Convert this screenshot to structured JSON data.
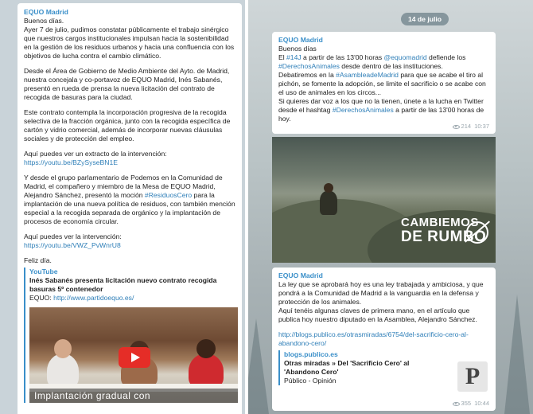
{
  "left_message": {
    "sender": "EQUO Madrid",
    "greeting": "Buenos días.",
    "p1": "Ayer 7 de julio, pudimos constatar públicamente el trabajo sinérgico que nuestros cargos institucionales impulsan hacia la sostenibilidad en la gestión de los residuos urbanos y hacia una confluencia con los objetivos de lucha contra el cambio climático.",
    "p2": "Desde el Área de Gobierno de Medio Ambiente del Ayto. de Madrid, nuestra concejala y co-portavoz de EQUO Madrid, Inés Sabanés, presentó en rueda de prensa la nueva licitación del contrato de recogida de basuras para la ciudad.",
    "p3": "Este contrato contempla la incorporación progresiva de la recogida selectiva de la fracción orgánica, junto con la recogida específica de cartón y vidrio comercial, además de incorporar nuevas cláusulas sociales y de protección del empleo.",
    "p4_text": "Aquí puedes ver un extracto de la intervención:",
    "p4_link": "https://youtu.be/BZySyseBN1E",
    "p5_before": "Y desde el grupo parlamentario de Podemos en la Comunidad de Madrid, el compañero y miembro de la Mesa de EQUO Madrid, Alejandro Sánchez, presentó la moción ",
    "p5_hashtag": "#ResiduosCero",
    "p5_after": " para la implantación de una nueva política de residuos, con también mención especial a la recogida separada de orgánico y la implantación de procesos de economía circular.",
    "p6_text": "Aquí puedes ver la intervención:",
    "p6_link": "https://youtu.be/VWZ_PvWnrU8",
    "closing": "Feliz día.",
    "preview": {
      "site": "YouTube",
      "title": "Inés Sabanés presenta licitación nuevo contrato recogida basuras 5º contenedor",
      "desc_prefix": "EQUO: ",
      "desc_link": "http://www.partidoequo.es/"
    },
    "video_caption": "Implantación gradual con"
  },
  "right_panel": {
    "date": "14 de julio",
    "msg1": {
      "sender": "EQUO Madrid",
      "greeting": "Buenos días",
      "l1_a": "El ",
      "l1_hash": "#14J",
      "l1_b": " a partir de las 13'00 horas ",
      "l1_mention": "@equomadrid",
      "l1_c": " defiende los",
      "l2_hash": "#DerechosAnimales",
      "l2_b": " desde dentro de  las instituciones.",
      "l3_a": "Debatiremos en la ",
      "l3_hash": "#AsambleadeMadrid",
      "l3_b": " para que se acabe el tiro al pichón, se fomente la adopción, se limite el sacrificio o se acabe con el uso de animales en los circos...",
      "l4_a": "Si quieres dar voz a los que no la tienen, únete a la lucha en Twitter desde el hashtag ",
      "l4_hash": "#DerechosAnimales",
      "l4_b": " a partir de las 13'00 horas de hoy.",
      "views": "214",
      "time": "10:37"
    },
    "photo": {
      "brand_line1": "CAMBIEMOS",
      "brand_line2": "DE RUMBO"
    },
    "msg2": {
      "sender": "EQUO Madrid",
      "text1": "La ley que se aprobará hoy es una ley trabajada y ambiciosa, y que pondrá a la Comunidad de Madrid a la vanguardia en la defensa y protección de los animales.",
      "text2": "Aquí tenéis algunas claves de primera mano, en el artículo que publica hoy nuestro diputado en la Asamblea, Alejandro Sánchez.",
      "link": "http://blogs.publico.es/otrasmiradas/6754/del-sacrificio-cero-al-abandono-cero/",
      "preview_site": "blogs.publico.es",
      "preview_title": "Otras miradas » Del 'Sacrificio Cero' al 'Abandono Cero'",
      "preview_desc": "Público - Opinión",
      "thumb_letter": "P",
      "views": "355",
      "time": "10:44"
    }
  }
}
